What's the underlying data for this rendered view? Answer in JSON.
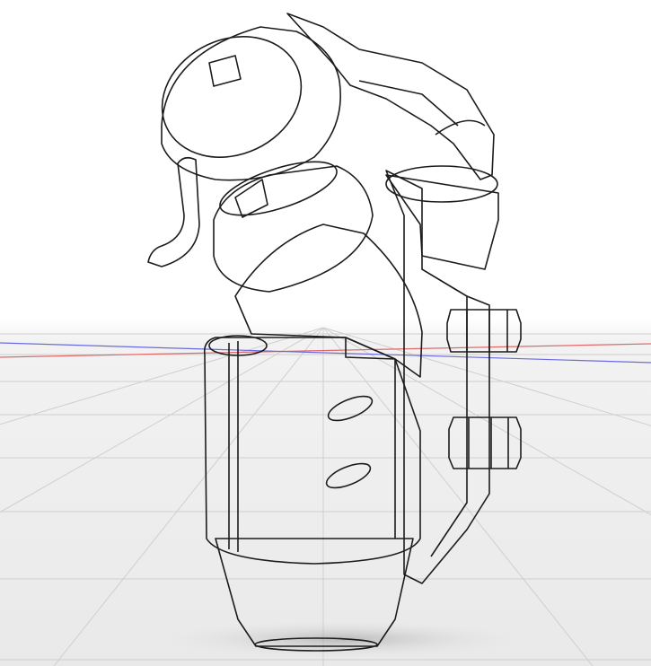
{
  "scene": {
    "type": "cad-viewport",
    "subject": "3d-model-part",
    "ground_grid": true,
    "axes": [
      "x",
      "z"
    ],
    "colors": {
      "background": "#ffffff",
      "ground": "#ececec",
      "grid_line": "#cfcfcf",
      "x_axis": "#e06a6a",
      "z_axis": "#6a6ae0",
      "model_base": "#8e8a80",
      "model_light": "#b8b4aa",
      "model_dark": "#55524c",
      "edge": "#1c1c1c"
    }
  }
}
